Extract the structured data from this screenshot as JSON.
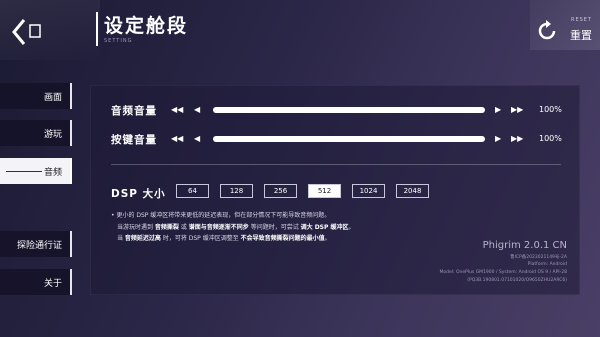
{
  "header": {
    "title": "设定舱段",
    "subtitle": "SETTING",
    "reset_en": "RESET",
    "reset_cn": "重置"
  },
  "sidebar": {
    "items": [
      {
        "label": "画面",
        "active": false
      },
      {
        "label": "游玩",
        "active": false
      },
      {
        "label": "音频",
        "active": true
      },
      {
        "label": "探险通行证",
        "active": false
      },
      {
        "label": "关于",
        "active": false
      }
    ]
  },
  "audio": {
    "music": {
      "label": "音频音量",
      "value_text": "100%",
      "value": 1.0
    },
    "key": {
      "label": "按键音量",
      "value_text": "100%",
      "value": 1.0
    }
  },
  "dsp": {
    "label": "DSP 大小",
    "options": [
      "64",
      "128",
      "256",
      "512",
      "1024",
      "2048"
    ],
    "selected": "512"
  },
  "notes": {
    "line1": "• 更小的 DSP 缓冲区将带来更低的延迟表现，但在部分情况下可能导致音频问题。",
    "line2_a": "当游玩时遇到 ",
    "line2_b": "音频撕裂",
    "line2_c": " 或 ",
    "line2_d": "谱面与音频逐渐不同步",
    "line2_e": " 等问题时，可尝试 ",
    "line2_f": "调大 DSP 缓冲区",
    "line2_g": "。",
    "line3_a": "当 ",
    "line3_b": "音频延迟过高",
    "line3_c": " 时，可将 DSP 缓冲区调整至 ",
    "line3_d": "不会导致音频撕裂问题的最小值",
    "line3_e": "。"
  },
  "version": {
    "name": "Phigrim 2.0.1 CN",
    "icp": "鲁ICP备2023021149号-2A",
    "platform": "Platform: Android",
    "model": "Model: OnePlus GM1900 / System: Android OS 9 / API-28",
    "build": "(PQ3B.190801.07101020/O9650ZHU2ARC6)"
  },
  "icons": {
    "back": "back-arrow-icon",
    "reset": "reset-icon"
  },
  "colors": {
    "background": "#2a2647",
    "accent": "#ffffff",
    "selected_bg": "#f4f4f8"
  }
}
